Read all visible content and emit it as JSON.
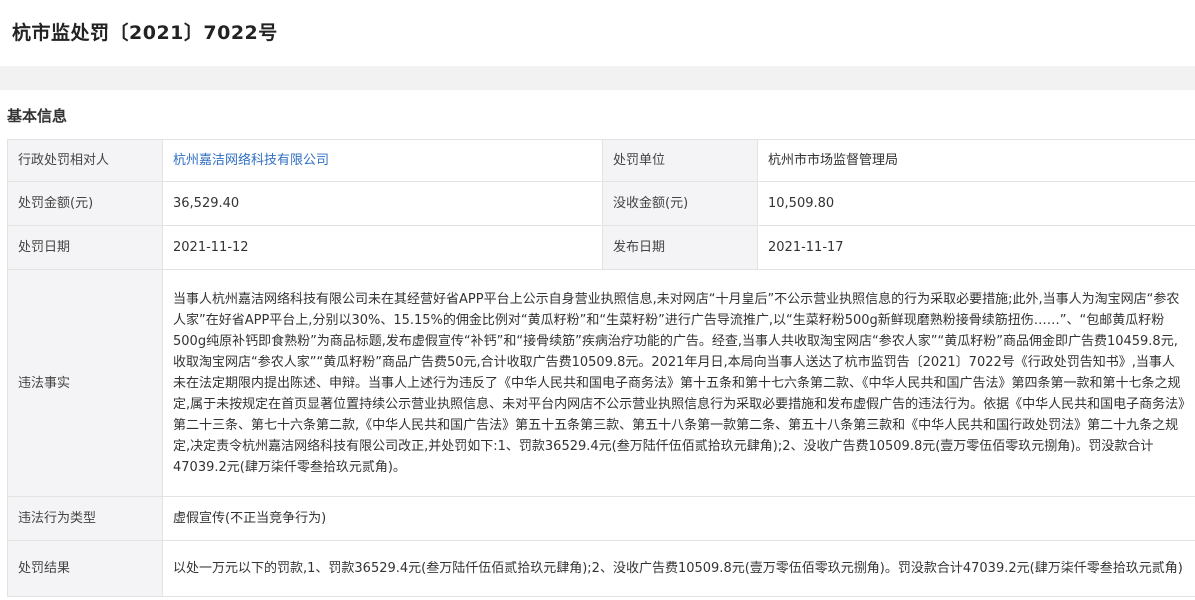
{
  "page": {
    "title": "杭市监处罚〔2021〕7022号"
  },
  "section": {
    "title": "基本信息"
  },
  "info": {
    "party_label": "行政处罚相对人",
    "party_value": "杭州嘉洁网络科技有限公司",
    "unit_label": "处罚单位",
    "unit_value": "杭州市市场监督管理局",
    "amount_label": "处罚金额(元)",
    "amount_value": "36,529.40",
    "confiscation_label": "没收金额(元)",
    "confiscation_value": "10,509.80",
    "date_label": "处罚日期",
    "date_value": "2021-11-12",
    "publish_label": "发布日期",
    "publish_value": "2021-11-17",
    "facts_label": "违法事实",
    "facts_value": "当事人杭州嘉洁网络科技有限公司未在其经营好省APP平台上公示自身营业执照信息,未对网店“十月皇后”不公示营业执照信息的行为采取必要措施;此外,当事人为淘宝网店“参农人家”在好省APP平台上,分别以30%、15.15%的佣金比例对“黄瓜籽粉”和“生菜籽粉”进行广告导流推广,以“生菜籽粉500g新鲜现磨熟粉接骨续筋扭伤……”、“包邮黄瓜籽粉500g纯原补钙即食熟粉”为商品标题,发布虚假宣传“补钙”和“接骨续筋”疾病治疗功能的广告。经查,当事人共收取淘宝网店“参农人家”“黄瓜籽粉”商品佣金即广告费10459.8元,收取淘宝网店“参农人家”“黄瓜籽粉”商品广告费50元,合计收取广告费10509.8元。2021年月日,本局向当事人送达了杭市监罚告〔2021〕7022号《行政处罚告知书》,当事人未在法定期限内提出陈述、申辩。当事人上述行为违反了《中华人民共和国电子商务法》第十五条和第十七六条第二款、《中华人民共和国广告法》第四条第一款和第十七条之规定,属于未按规定在首页显著位置持续公示营业执照信息、未对平台内网店不公示营业执照信息行为采取必要措施和发布虚假广告的违法行为。依据《中华人民共和国电子商务法》第二十三条、第七十六条第二款,《中华人民共和国广告法》第五十五条第三款、第五十八条第一款第二条、第五十八条第三款和《中华人民共和国行政处罚法》第二十九条之规定,决定责令杭州嘉洁网络科技有限公司改正,并处罚如下:1、罚款36529.4元(叁万陆仟伍佰贰拾玖元肆角);2、没收广告费10509.8元(壹万零伍佰零玖元捌角)。罚没款合计47039.2元(肆万柒仟零叁拾玖元贰角)。",
    "type_label": "违法行为类型",
    "type_value": "虚假宣传(不正当竞争行为)",
    "result_label": "处罚结果",
    "result_value": "以处一万元以下的罚款,1、罚款36529.4元(叁万陆仟伍佰贰拾玖元肆角);2、没收广告费10509.8元(壹万零伍佰零玖元捌角)。罚没款合计47039.2元(肆万柒仟零叁拾玖元贰角)"
  }
}
